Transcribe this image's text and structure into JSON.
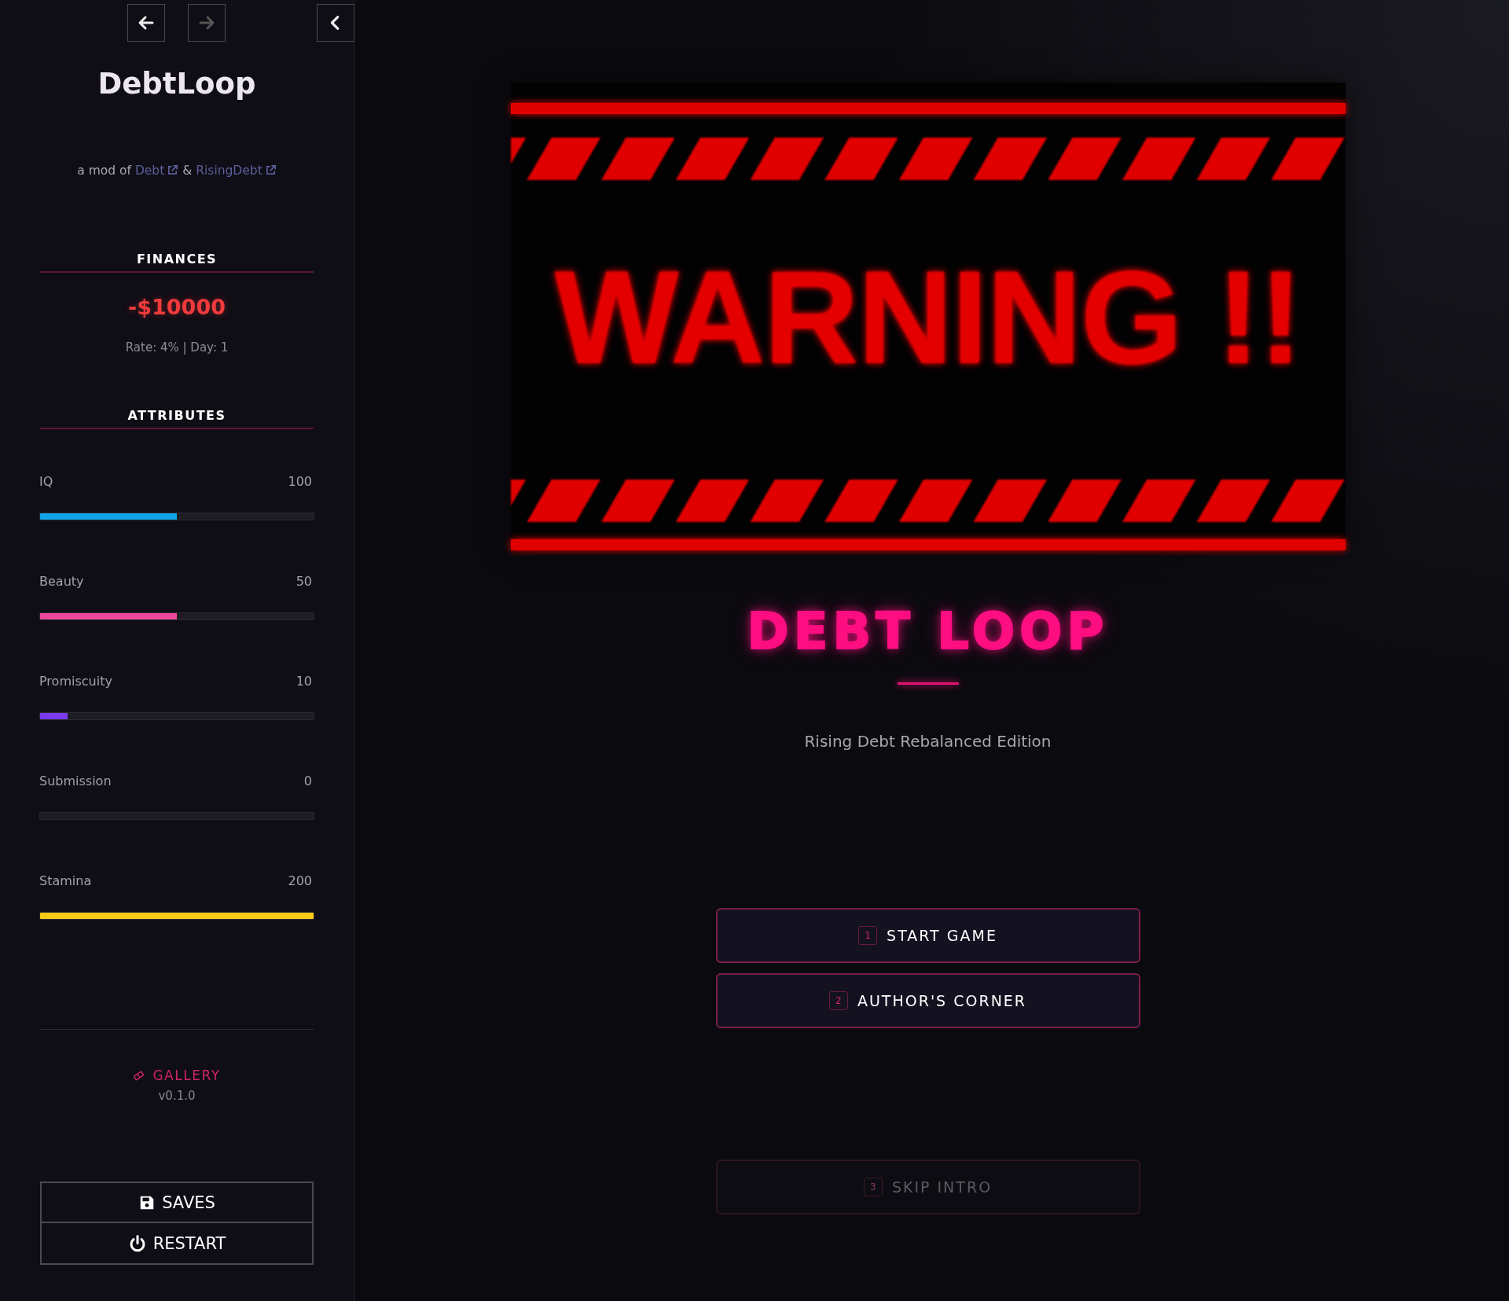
{
  "nav": {
    "back": {
      "disabled": false
    },
    "forward": {
      "disabled": true
    },
    "collapse": {
      "disabled": false
    }
  },
  "sidebar": {
    "title": "DebtLoop",
    "credit": {
      "prefix": "a mod of",
      "joiner": "&",
      "links": [
        {
          "label": "Debt"
        },
        {
          "label": "RisingDebt"
        }
      ]
    },
    "finances": {
      "heading": "FINANCES",
      "amount": "-$10000",
      "details": "Rate: 4% | Day: 1"
    },
    "attributes": {
      "heading": "ATTRIBUTES",
      "items": [
        {
          "name": "IQ",
          "value": "100",
          "level": 0.5,
          "color": "#0ea5e9"
        },
        {
          "name": "Beauty",
          "value": "50",
          "level": 0.5,
          "color": "#ec4899"
        },
        {
          "name": "Promiscuity",
          "value": "10",
          "level": 0.1,
          "color": "#7c3aed"
        },
        {
          "name": "Submission",
          "value": "0",
          "level": 0
        },
        {
          "name": "Stamina",
          "value": "200",
          "level": 1,
          "color": "#facc15"
        }
      ]
    },
    "gallery": "GALLERY",
    "version": "v0.1.0",
    "buttons": [
      {
        "label": "SAVES",
        "kind": "saves"
      },
      {
        "label": "RESTART",
        "kind": "restart"
      }
    ]
  },
  "main": {
    "banner": {
      "text": "WARNING !!"
    },
    "title": "DEBT LOOP",
    "subtitle": "Rising Debt Rebalanced Edition",
    "menu": [
      {
        "hotkey": "1",
        "label": "START GAME",
        "disabled": false
      },
      {
        "hotkey": "2",
        "label": "AUTHOR'S CORNER",
        "disabled": false
      }
    ],
    "skip": {
      "hotkey": "3",
      "label": "SKIP INTRO",
      "disabled": true
    }
  }
}
